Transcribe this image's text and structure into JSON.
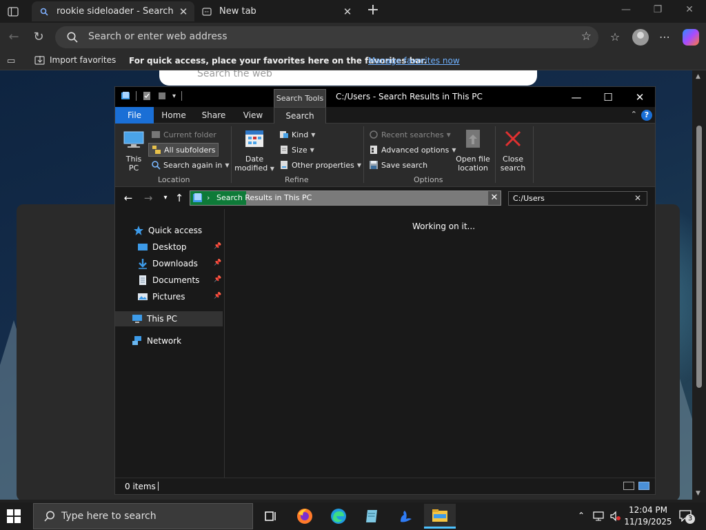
{
  "browser": {
    "tabs": [
      {
        "title": "rookie sideloader - Search",
        "icon": "search-icon"
      },
      {
        "title": "New tab",
        "icon": "newtab-icon"
      }
    ],
    "address_placeholder": "Search or enter web address",
    "favorites_bar": {
      "import_label": "Import favorites",
      "hint": "For quick access, place your favorites here on the favorites bar.",
      "manage_link": "Manage favorites now"
    },
    "page_search_placeholder": "Search the web"
  },
  "explorer": {
    "title": "C:/Users - Search Results in This PC",
    "contextual_tab": "Search Tools",
    "ribbon_tabs": [
      "File",
      "Home",
      "Share",
      "View",
      "Search"
    ],
    "active_tab": "Search",
    "groups": {
      "location": {
        "label": "Location",
        "this_pc": "This PC",
        "current_folder": "Current folder",
        "all_subfolders": "All subfolders",
        "search_again": "Search again in"
      },
      "refine": {
        "label": "Refine",
        "date_modified": "Date modified",
        "kind": "Kind",
        "size": "Size",
        "other_properties": "Other properties"
      },
      "options": {
        "label": "Options",
        "recent_searches": "Recent searches",
        "advanced_options": "Advanced options",
        "save_search": "Save search",
        "open_file_location": "Open file location",
        "close_search": "Close search"
      }
    },
    "address": {
      "crumb": "Search Results in This PC",
      "progress": 0.18
    },
    "search_box_value": "C:/Users",
    "nav": {
      "quick_access": "Quick access",
      "items": [
        {
          "label": "Desktop",
          "icon": "desktop-icon"
        },
        {
          "label": "Downloads",
          "icon": "downloads-icon"
        },
        {
          "label": "Documents",
          "icon": "documents-icon"
        },
        {
          "label": "Pictures",
          "icon": "pictures-icon"
        }
      ],
      "this_pc": "This PC",
      "network": "Network"
    },
    "status_message": "Working on it...",
    "item_count": "0 items"
  },
  "taskbar": {
    "search_placeholder": "Type here to search",
    "time": "12:04 PM",
    "date": "11/19/2025",
    "notification_count": "3"
  },
  "colors": {
    "accent_blue": "#1a6fd6",
    "link": "#6fb1ff",
    "progress_green": "#0e7a38"
  }
}
